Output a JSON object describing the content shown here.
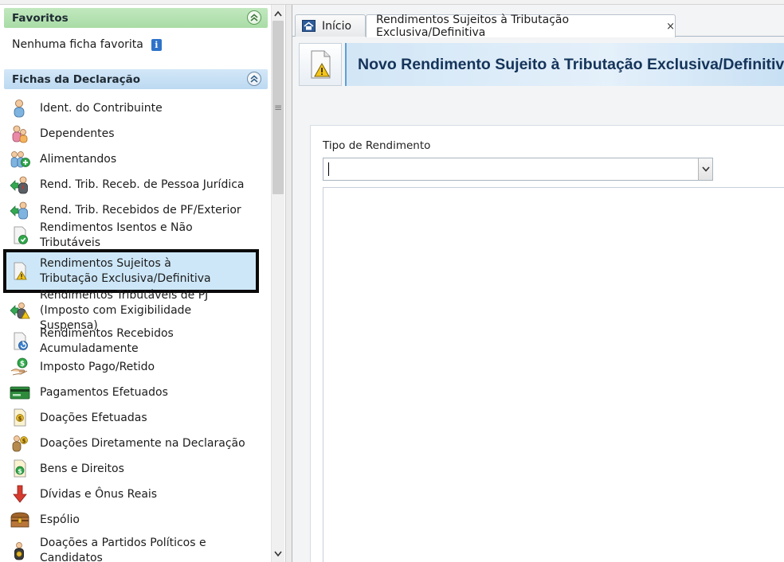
{
  "favorites": {
    "header": "Favoritos",
    "empty_text": "Nenhuma ficha favorita"
  },
  "fichas": {
    "header": "Fichas da Declaração",
    "items": [
      {
        "label": "Ident. do Contribuinte",
        "icon": "person-icon"
      },
      {
        "label": "Dependentes",
        "icon": "dependents-icon"
      },
      {
        "label": "Alimentandos",
        "icon": "alimentandos-icon"
      },
      {
        "label": "Rend. Trib. Receb. de Pessoa Jurídica",
        "icon": "income-pj-icon"
      },
      {
        "label": "Rend. Trib. Recebidos de PF/Exterior",
        "icon": "income-pf-icon"
      },
      {
        "label": "Rendimentos Isentos e Não Tributáveis",
        "icon": "exempt-income-icon"
      },
      {
        "label": "Rendimentos Sujeitos à Tributação Exclusiva/Definitiva",
        "icon": "exclusive-tax-icon",
        "selected": true
      },
      {
        "label": "Rendimentos Tributáveis de PJ (Imposto com Exigibilidade Suspensa)",
        "icon": "suspended-tax-icon"
      },
      {
        "label": "Rendimentos Recebidos Acumuladamente",
        "icon": "accumulated-income-icon"
      },
      {
        "label": "Imposto Pago/Retido",
        "icon": "tax-paid-icon"
      },
      {
        "label": "Pagamentos Efetuados",
        "icon": "payments-icon"
      },
      {
        "label": "Doações Efetuadas",
        "icon": "donations-icon"
      },
      {
        "label": "Doações Diretamente na Declaração",
        "icon": "direct-donations-icon"
      },
      {
        "label": "Bens e Direitos",
        "icon": "assets-icon"
      },
      {
        "label": "Dívidas e Ônus Reais",
        "icon": "debts-icon"
      },
      {
        "label": "Espólio",
        "icon": "estate-icon"
      },
      {
        "label": "Doações a Partidos Políticos e Candidatos",
        "icon": "political-donations-icon"
      }
    ]
  },
  "tabs": {
    "home": "Início",
    "active": "Rendimentos Sujeitos à Tributação Exclusiva/Definitiva",
    "close_symbol": "×"
  },
  "banner": {
    "title": "Novo Rendimento Sujeito à Tributação Exclusiva/Definitiva"
  },
  "form": {
    "tipo_label": "Tipo de Rendimento",
    "tipo_value": ""
  },
  "colors": {
    "favorites_header": "#a9dca5",
    "fichas_header": "#bcd9f1",
    "selected_item": "#cde7f8",
    "banner_title": "#15345a"
  }
}
